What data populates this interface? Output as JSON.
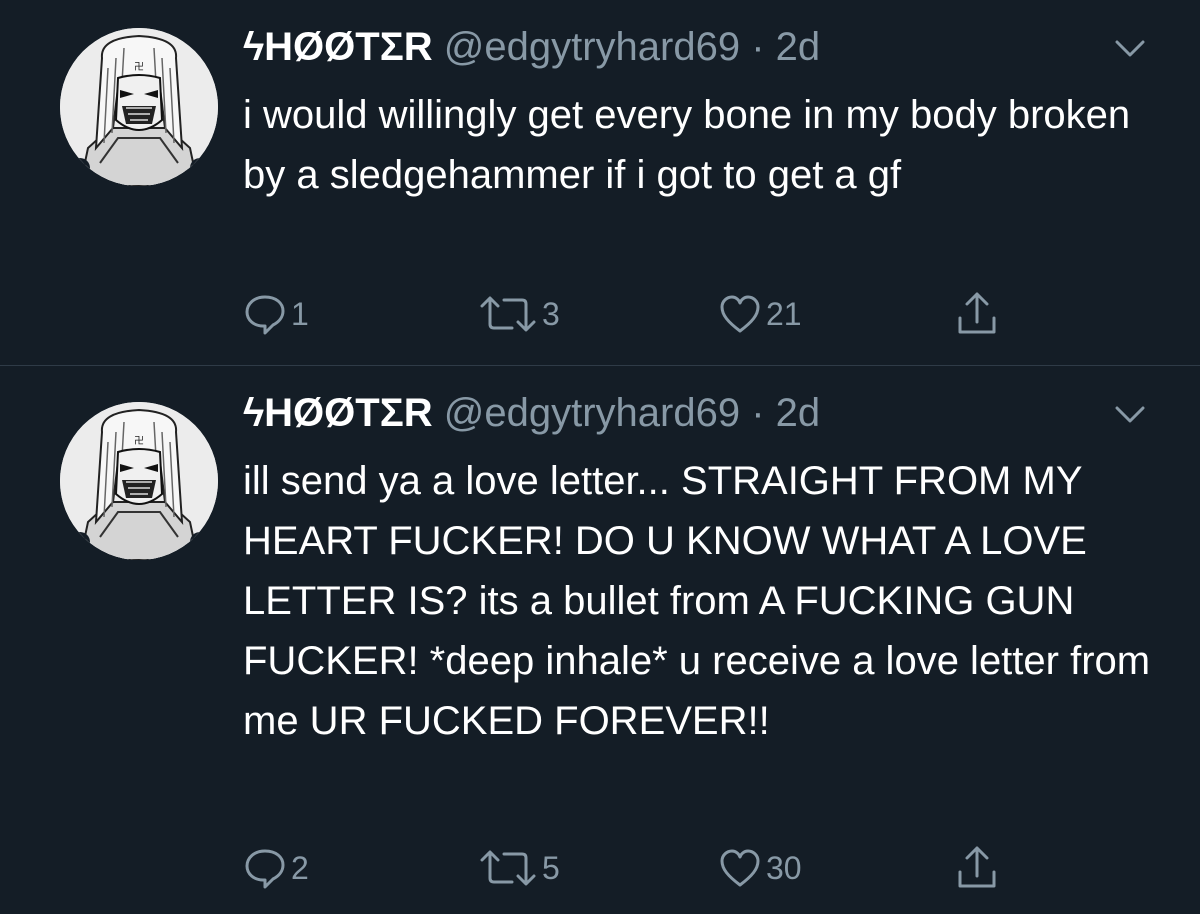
{
  "tweets": [
    {
      "display_name": "ϟHØØTΣR",
      "handle": "@edgytryhard69",
      "separator": "·",
      "time": "2d",
      "text": "i would willingly get every bone in my body broken by a sledgehammer if i got to get a gf",
      "replies": "1",
      "retweets": "3",
      "likes": "21"
    },
    {
      "display_name": "ϟHØØTΣR",
      "handle": "@edgytryhard69",
      "separator": "·",
      "time": "2d",
      "text": "ill send ya a love letter... STRAIGHT FROM MY HEART FUCKER! DO U KNOW WHAT A LOVE LETTER IS? its a bullet from A FUCKING GUN FUCKER! *deep inhale* u receive a love letter from me UR FUCKED FOREVER!!",
      "replies": "2",
      "retweets": "5",
      "likes": "30"
    }
  ],
  "icons": {
    "reply": "reply-icon",
    "retweet": "retweet-icon",
    "like": "heart-icon",
    "share": "share-icon",
    "menu": "chevron-down-icon"
  },
  "colors": {
    "background": "#141d26",
    "secondary_text": "#8899a6",
    "primary_text": "#ffffff",
    "divider": "#2f3b47"
  }
}
